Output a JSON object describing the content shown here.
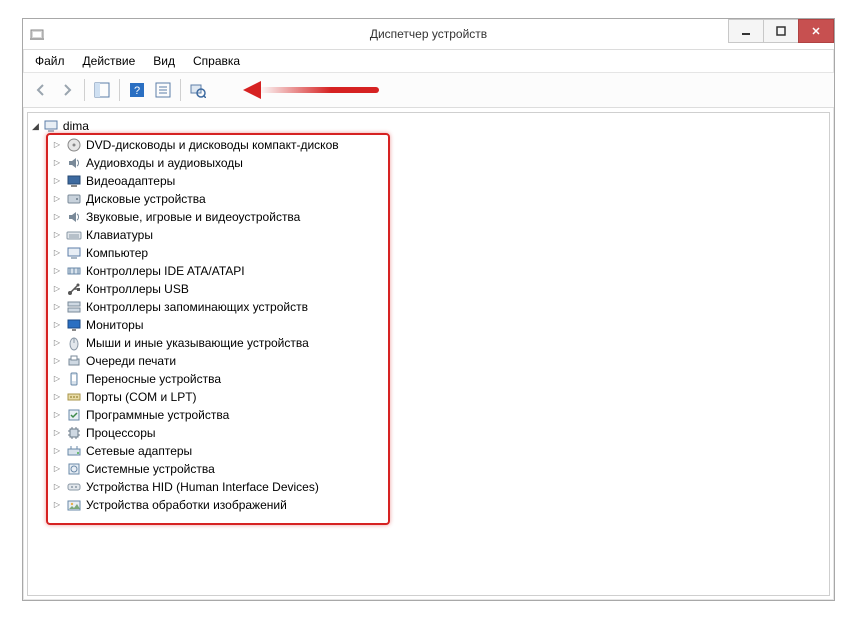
{
  "window": {
    "title": "Диспетчер устройств"
  },
  "menu": {
    "items": [
      "Файл",
      "Действие",
      "Вид",
      "Справка"
    ]
  },
  "tree": {
    "root": "dima",
    "nodes": [
      {
        "icon": "disc",
        "label": "DVD-дисководы и дисководы компакт-дисков"
      },
      {
        "icon": "audio",
        "label": "Аудиовходы и аудиовыходы"
      },
      {
        "icon": "display",
        "label": "Видеоадаптеры"
      },
      {
        "icon": "disk",
        "label": "Дисковые устройства"
      },
      {
        "icon": "audio",
        "label": "Звуковые, игровые и видеоустройства"
      },
      {
        "icon": "keyboard",
        "label": "Клавиатуры"
      },
      {
        "icon": "computer",
        "label": "Компьютер"
      },
      {
        "icon": "ide",
        "label": "Контроллеры IDE ATA/ATAPI"
      },
      {
        "icon": "usb",
        "label": "Контроллеры USB"
      },
      {
        "icon": "storage",
        "label": "Контроллеры запоминающих устройств"
      },
      {
        "icon": "monitor",
        "label": "Мониторы"
      },
      {
        "icon": "mouse",
        "label": "Мыши и иные указывающие устройства"
      },
      {
        "icon": "printq",
        "label": "Очереди печати"
      },
      {
        "icon": "portable",
        "label": "Переносные устройства"
      },
      {
        "icon": "port",
        "label": "Порты (COM и LPT)"
      },
      {
        "icon": "software",
        "label": "Программные устройства"
      },
      {
        "icon": "cpu",
        "label": "Процессоры"
      },
      {
        "icon": "net",
        "label": "Сетевые адаптеры"
      },
      {
        "icon": "system",
        "label": "Системные устройства"
      },
      {
        "icon": "hid",
        "label": "Устройства HID (Human Interface Devices)"
      },
      {
        "icon": "image",
        "label": "Устройства обработки изображений"
      }
    ]
  }
}
